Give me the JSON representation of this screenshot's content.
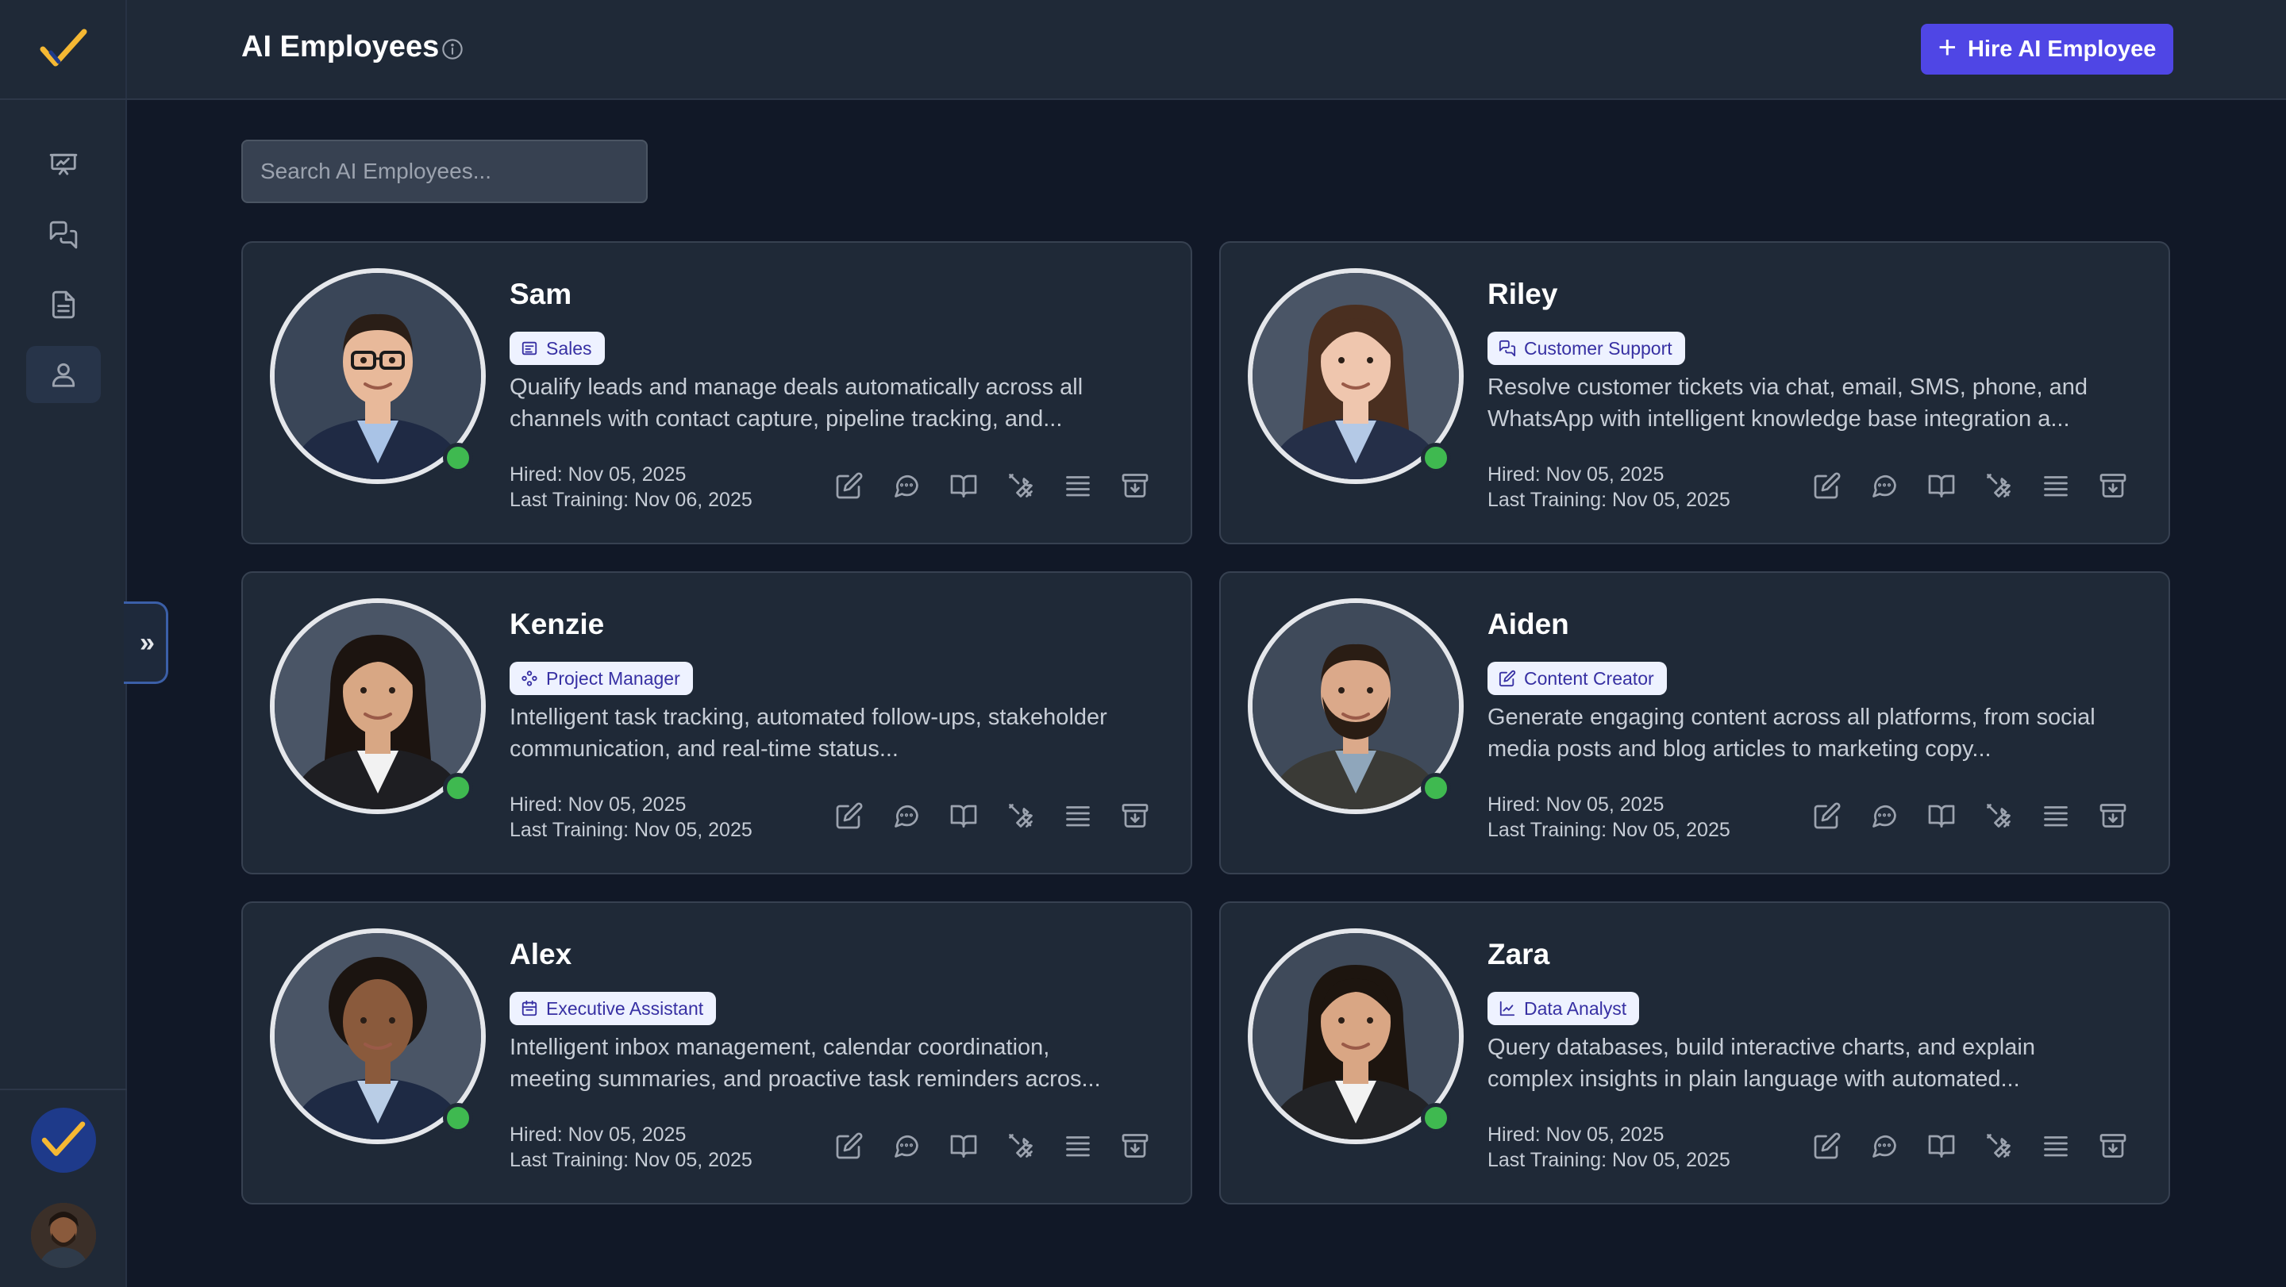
{
  "header": {
    "title": "AI Employees",
    "hire_button_label": "Hire AI Employee"
  },
  "search": {
    "placeholder": "Search AI Employees...",
    "value": ""
  },
  "sidebar": {
    "items": [
      {
        "icon": "presentation-icon",
        "active": false
      },
      {
        "icon": "chat-bubbles-icon",
        "active": false
      },
      {
        "icon": "document-icon",
        "active": false
      },
      {
        "icon": "user-icon",
        "active": true
      }
    ]
  },
  "colors": {
    "accent": "#4f46e5",
    "status_online": "#3fb950",
    "brand_check": "#f5b833"
  },
  "employees": [
    {
      "name": "Sam",
      "role": "Sales",
      "role_icon": "sales-icon",
      "description": "Qualify leads and manage deals automatically across all channels with contact capture, pipeline tracking, and...",
      "hired": "Hired: Nov 05, 2025",
      "last_training": "Last Training: Nov 06, 2025",
      "status": "online"
    },
    {
      "name": "Riley",
      "role": "Customer Support",
      "role_icon": "chat-bubbles-icon",
      "description": "Resolve customer tickets via chat, email, SMS, phone, and WhatsApp with intelligent knowledge base integration a...",
      "hired": "Hired: Nov 05, 2025",
      "last_training": "Last Training: Nov 05, 2025",
      "status": "online"
    },
    {
      "name": "Kenzie",
      "role": "Project Manager",
      "role_icon": "workflow-icon",
      "description": "Intelligent task tracking, automated follow-ups, stakeholder communication, and real-time status...",
      "hired": "Hired: Nov 05, 2025",
      "last_training": "Last Training: Nov 05, 2025",
      "status": "online"
    },
    {
      "name": "Aiden",
      "role": "Content Creator",
      "role_icon": "pencil-square-icon",
      "description": "Generate engaging content across all platforms, from social media posts and blog articles to marketing copy...",
      "hired": "Hired: Nov 05, 2025",
      "last_training": "Last Training: Nov 05, 2025",
      "status": "online"
    },
    {
      "name": "Alex",
      "role": "Executive Assistant",
      "role_icon": "calendar-icon",
      "description": "Intelligent inbox management, calendar coordination, meeting summaries, and proactive task reminders acros...",
      "hired": "Hired: Nov 05, 2025",
      "last_training": "Last Training: Nov 05, 2025",
      "status": "online"
    },
    {
      "name": "Zara",
      "role": "Data Analyst",
      "role_icon": "line-chart-icon",
      "description": "Query databases, build interactive charts, and explain complex insights in plain language with automated...",
      "hired": "Hired: Nov 05, 2025",
      "last_training": "Last Training: Nov 05, 2025",
      "status": "online"
    }
  ],
  "card_actions": [
    "edit-icon",
    "chat-icon",
    "knowledge-book-icon",
    "tools-icon",
    "list-icon",
    "archive-icon"
  ]
}
